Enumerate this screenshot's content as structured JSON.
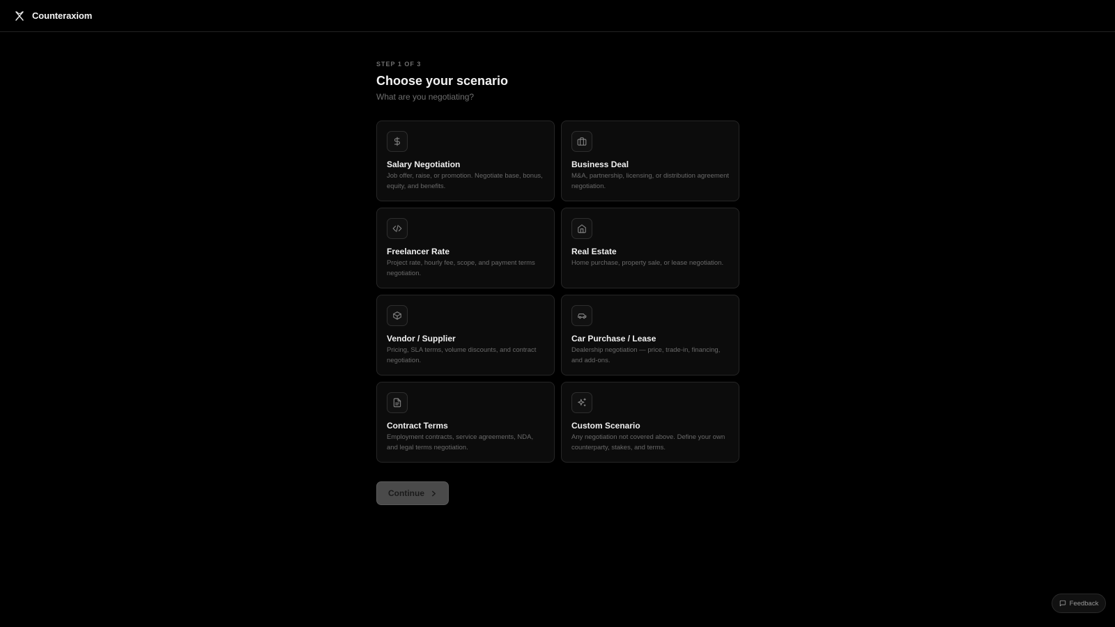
{
  "header": {
    "brand_name": "Counteraxiom",
    "logo_icon": "x-logo-icon"
  },
  "page": {
    "step_label": "STEP 1 OF 3",
    "title": "Choose your scenario",
    "subtitle": "What are you negotiating?"
  },
  "scenarios": [
    {
      "icon": "dollar-icon",
      "title": "Salary Negotiation",
      "description": "Job offer, raise, or promotion. Negotiate base, bonus, equity, and benefits."
    },
    {
      "icon": "briefcase-icon",
      "title": "Business Deal",
      "description": "M&A, partnership, licensing, or distribution agreement negotiation."
    },
    {
      "icon": "code-icon",
      "title": "Freelancer Rate",
      "description": "Project rate, hourly fee, scope, and payment terms negotiation."
    },
    {
      "icon": "home-icon",
      "title": "Real Estate",
      "description": "Home purchase, property sale, or lease negotiation."
    },
    {
      "icon": "package-icon",
      "title": "Vendor / Supplier",
      "description": "Pricing, SLA terms, volume discounts, and contract negotiation."
    },
    {
      "icon": "car-icon",
      "title": "Car Purchase / Lease",
      "description": "Dealership negotiation — price, trade-in, financing, and add-ons."
    },
    {
      "icon": "document-icon",
      "title": "Contract Terms",
      "description": "Employment contracts, service agreements, NDA, and legal terms negotiation."
    },
    {
      "icon": "sparkles-icon",
      "title": "Custom Scenario",
      "description": "Any negotiation not covered above. Define your own counterparty, stakes, and terms."
    }
  ],
  "actions": {
    "continue_label": "Continue",
    "continue_icon": "chevron-right-icon"
  },
  "feedback": {
    "label": "Feedback",
    "icon": "message-square-icon"
  },
  "colors": {
    "background": "#000000",
    "card_background": "#0c0c0c",
    "card_border": "#262626",
    "muted_text": "#6a6a6a",
    "button_disabled": "#4a4a4a"
  }
}
